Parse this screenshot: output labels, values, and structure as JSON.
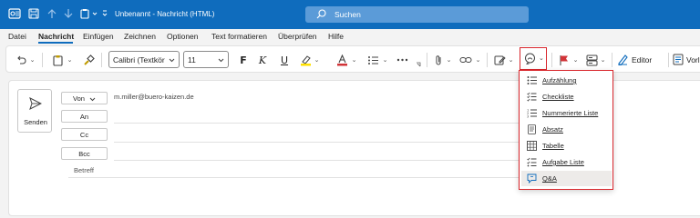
{
  "titlebar": {
    "title": "Unbenannt  -  Nachricht (HTML)",
    "search_placeholder": "Suchen",
    "icons": [
      "outlook-logo-icon",
      "save-icon",
      "up-arrow-icon",
      "down-arrow-icon",
      "paste-icon",
      "customize-chevron-icon"
    ]
  },
  "menu": {
    "items": [
      "Datei",
      "Nachricht",
      "Einfügen",
      "Zeichnen",
      "Optionen",
      "Text formatieren",
      "Überprüfen",
      "Hilfe"
    ],
    "active": "Nachricht"
  },
  "ribbon": {
    "font_name": "Calibri (Textkör",
    "font_size": "11",
    "bold": "F",
    "italic": "K",
    "underline": "U",
    "editor_label": "Editor",
    "vorlagen_label": "Vorl"
  },
  "compose": {
    "send_label": "Senden",
    "from_label": "Von",
    "from_value": "m.miller@buero-kaizen.de",
    "to_label": "An",
    "cc_label": "Cc",
    "bcc_label": "Bcc",
    "subject_label": "Betreff"
  },
  "dropdown": {
    "items": [
      {
        "label": "Aufzählung",
        "icon": "bulleted-list-icon"
      },
      {
        "label": "Checkliste",
        "icon": "checklist-icon"
      },
      {
        "label": "Nummerierte Liste",
        "icon": "numbered-list-icon"
      },
      {
        "label": "Absatz",
        "icon": "paragraph-icon"
      },
      {
        "label": "Tabelle",
        "icon": "table-icon"
      },
      {
        "label": "Aufgabe Liste",
        "icon": "task-list-icon"
      },
      {
        "label": "Q&A",
        "icon": "qa-icon"
      }
    ],
    "highlighted": "Q&A"
  },
  "colors": {
    "titlebar": "#0f6cbd",
    "highlight_border": "#d9262c",
    "accent_blue": "#0f6cbd"
  }
}
